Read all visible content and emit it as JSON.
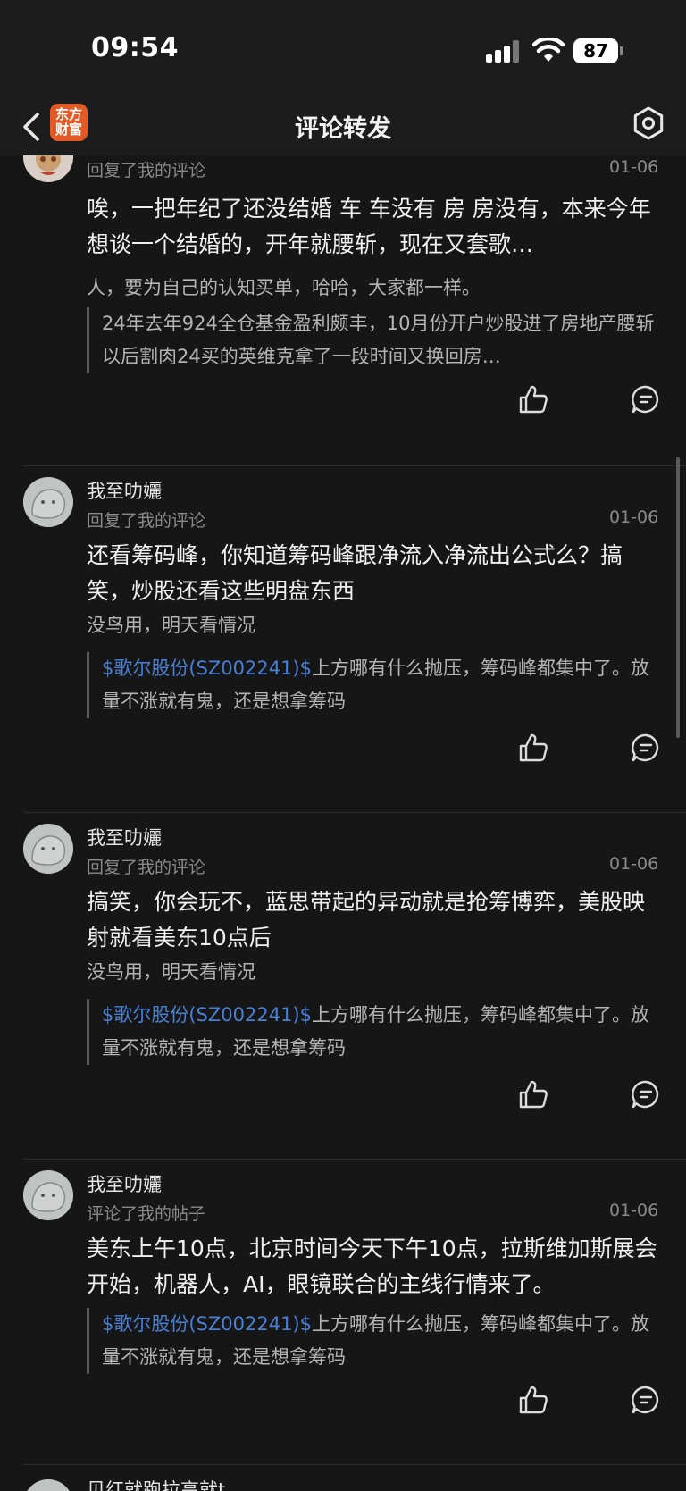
{
  "status": {
    "time": "09:54",
    "battery": "87"
  },
  "nav": {
    "logo_line1": "东方",
    "logo_line2": "财富",
    "title": "评论转发"
  },
  "items": [
    {
      "action": "回复了我的评论",
      "date": "01-06",
      "text": "唉，一把年纪了还没结婚 车 车没有 房 房没有，本来今年想谈一个结婚的，开年就腰斩，现在又套歌…",
      "sub": "人，要为自己的认知买单，哈哈，大家都一样。",
      "quote_stock": "",
      "quote_text": "24年去年924全仓基金盈利颇丰，10月份开户炒股进了房地产腰斩以后割肉24买的英维克拿了一段时间又换回房…"
    },
    {
      "username": "我至叻孋",
      "action": "回复了我的评论",
      "date": "01-06",
      "text": "还看筹码峰，你知道筹码峰跟净流入净流出公式么？搞笑，炒股还看这些明盘东西",
      "sub": "没鸟用，明天看情况",
      "quote_stock": "$歌尔股份(SZ002241)$",
      "quote_text": "上方哪有什么抛压，筹码峰都集中了。放量不涨就有鬼，还是想拿筹码"
    },
    {
      "username": "我至叻孋",
      "action": "回复了我的评论",
      "date": "01-06",
      "text": "搞笑，你会玩不，蓝思带起的异动就是抢筹博弈，美股映射就看美东10点后",
      "sub": "没鸟用，明天看情况",
      "quote_stock": "$歌尔股份(SZ002241)$",
      "quote_text": "上方哪有什么抛压，筹码峰都集中了。放量不涨就有鬼，还是想拿筹码"
    },
    {
      "username": "我至叻孋",
      "action": "评论了我的帖子",
      "date": "01-06",
      "text": "美东上午10点，北京时间今天下午10点，拉斯维加斯展会开始，机器人，AI，眼镜联合的主线行情来了。",
      "quote_stock": "$歌尔股份(SZ002241)$",
      "quote_text": "上方哪有什么抛压，筹码峰都集中了。放量不涨就有鬼，还是想拿筹码"
    },
    {
      "username": "贝红就跑拉高就t"
    }
  ]
}
